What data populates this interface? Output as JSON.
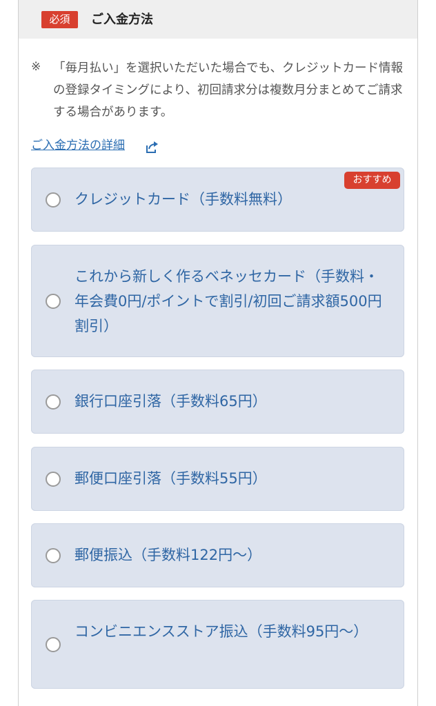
{
  "header": {
    "required_badge": "必須",
    "title": "ご入金方法"
  },
  "note": {
    "mark": "※",
    "text": "「毎月払い」を選択いただいた場合でも、クレジットカード情報の登録タイミングにより、初回請求分は複数月分まとめてご請求する場合があります。"
  },
  "detail_link": {
    "label": "ご入金方法の詳細",
    "icon": "external-link-icon"
  },
  "colors": {
    "accent_red": "#d8402f",
    "link_blue": "#2a6db2",
    "option_bg": "#dde3ee",
    "option_text": "#2f66a4"
  },
  "payment_options": [
    {
      "label": "クレジットカード（手数料無料）",
      "badge": "おすすめ",
      "selected": false
    },
    {
      "label": "これから新しく作るベネッセカード（手数料・年会費0円/ポイントで割引/初回ご請求額500円割引）",
      "selected": false
    },
    {
      "label": "銀行口座引落（手数料65円）",
      "selected": false
    },
    {
      "label": "郵便口座引落（手数料55円）",
      "selected": false
    },
    {
      "label": "郵便振込（手数料122円～）",
      "selected": false
    },
    {
      "label": "コンビニエンスストア振込（手数料95円～）",
      "selected": false
    }
  ]
}
